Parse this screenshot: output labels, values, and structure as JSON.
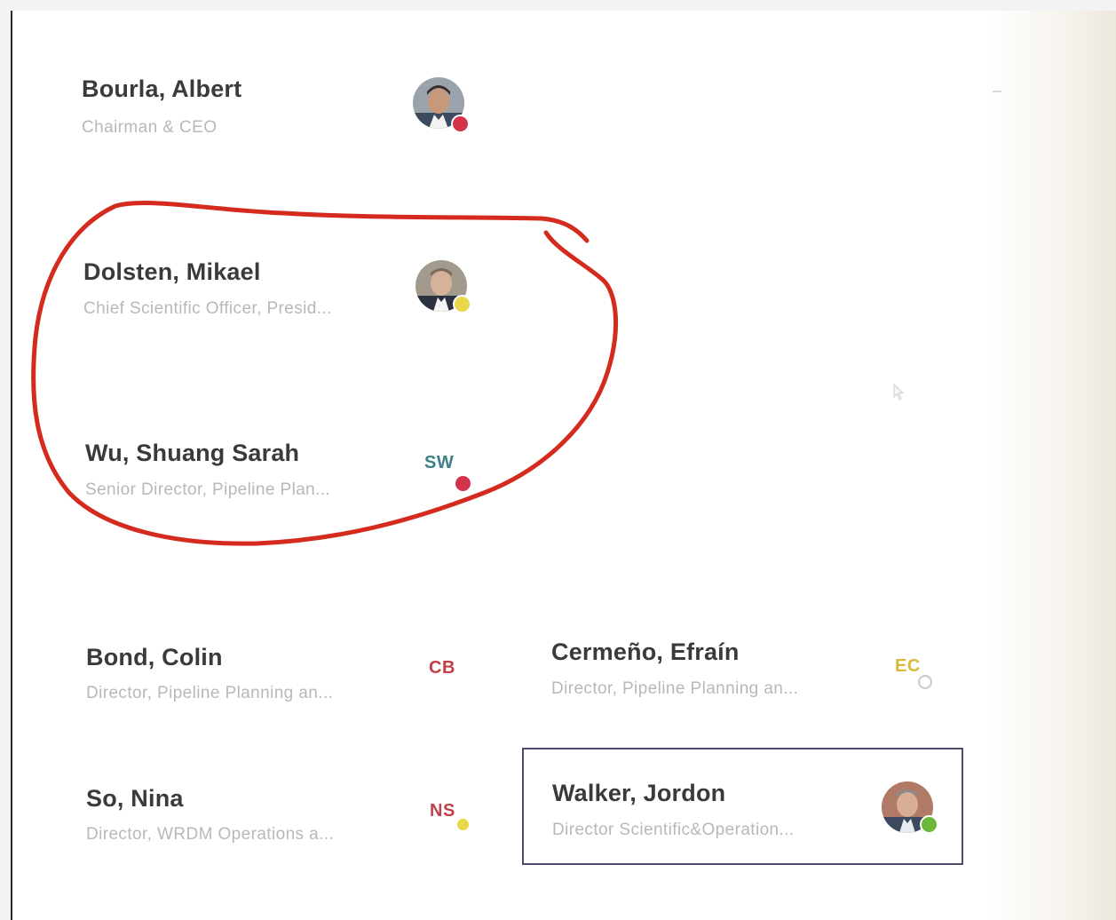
{
  "people": [
    {
      "id": "bourla",
      "name": "Bourla, Albert",
      "title": "Chairman & CEO",
      "avatar": "photo",
      "status": "busy"
    },
    {
      "id": "dolsten",
      "name": "Dolsten, Mikael",
      "title": "Chief Scientific Officer, Presid...",
      "avatar": "photo",
      "status": "away"
    },
    {
      "id": "wu",
      "name": "Wu, Shuang Sarah",
      "title": "Senior Director, Pipeline Plan...",
      "initials": "SW",
      "status": "busy"
    },
    {
      "id": "bond",
      "name": "Bond, Colin",
      "title": "Director, Pipeline Planning an...",
      "initials": "CB",
      "status": "none"
    },
    {
      "id": "cermeno",
      "name": "Cermeño, Efraín",
      "title": "Director, Pipeline Planning an...",
      "initials": "EC",
      "status": "offline"
    },
    {
      "id": "so",
      "name": "So, Nina",
      "title": "Director, WRDM Operations a...",
      "initials": "NS",
      "status": "away"
    },
    {
      "id": "walker",
      "name": "Walker, Jordon",
      "title": "Director Scientific&Operation...",
      "avatar": "photo",
      "status": "available",
      "selected": true
    }
  ],
  "colors": {
    "busy": "#d3344b",
    "away": "#e8d84a",
    "available": "#6bb83a",
    "initials_sw": "#3c7f86",
    "initials_cb": "#c0404a",
    "initials_ec": "#d8b93a",
    "initials_ns": "#c0404a",
    "annotation": "#d42b1e"
  },
  "icons": [
    "avatar-photo-icon",
    "presence-status-icon",
    "mouse-cursor-icon"
  ]
}
